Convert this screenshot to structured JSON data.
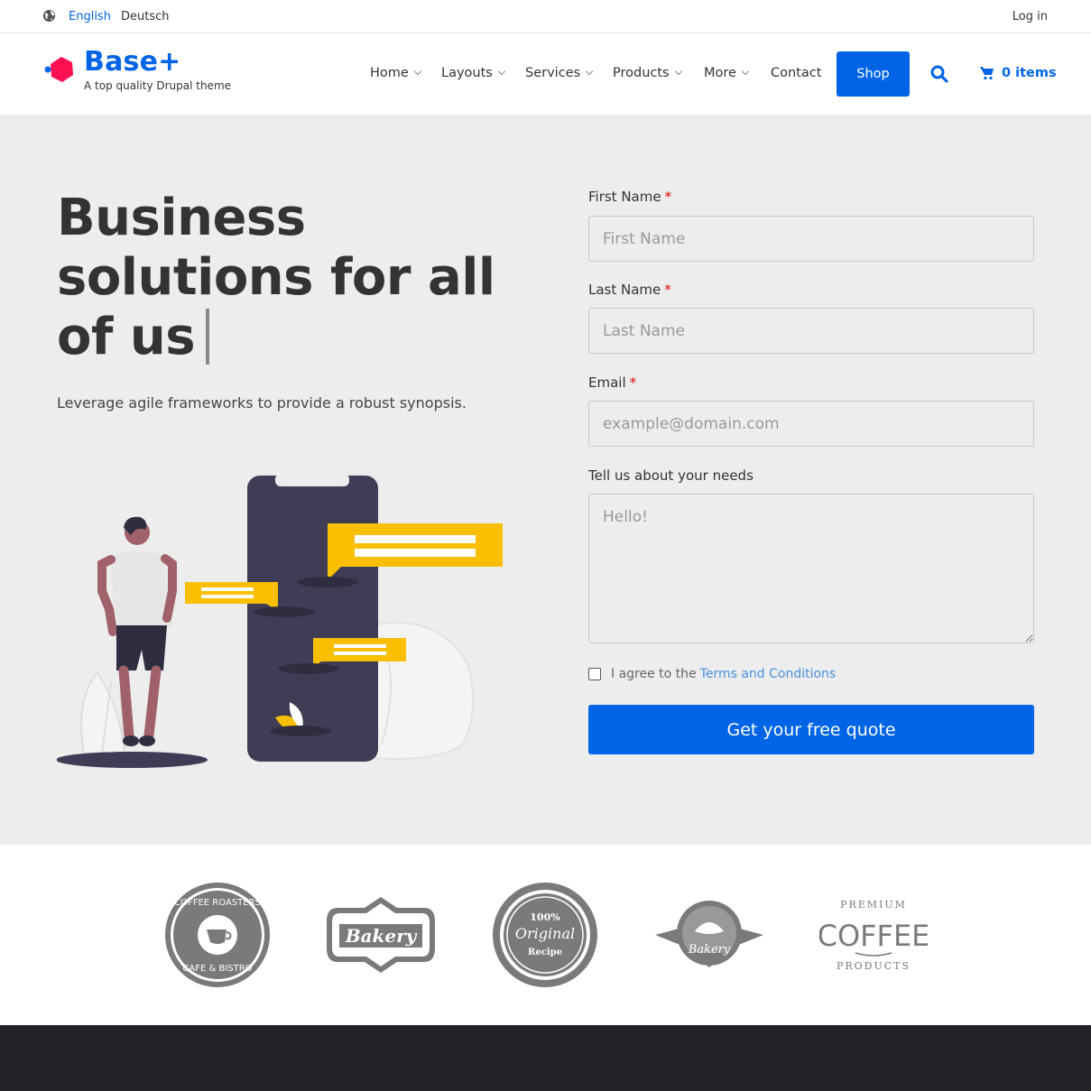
{
  "topbar": {
    "globe_icon": "globe-icon",
    "languages": [
      "English",
      "Deutsch"
    ],
    "active_language": "English",
    "login": "Log in"
  },
  "header": {
    "site_name": "Base+",
    "slogan": "A top quality Drupal theme",
    "nav": [
      {
        "label": "Home",
        "dropdown": true
      },
      {
        "label": "Layouts",
        "dropdown": true
      },
      {
        "label": "Services",
        "dropdown": true
      },
      {
        "label": "Products",
        "dropdown": true
      },
      {
        "label": "More",
        "dropdown": true
      },
      {
        "label": "Contact",
        "dropdown": false
      }
    ],
    "shop_label": "Shop",
    "search_icon": "search-icon",
    "cart_icon": "cart-icon",
    "cart_label": "0 items"
  },
  "hero": {
    "title": "Business solutions for all of us",
    "subtitle": "Leverage agile frameworks to provide a robust synopsis."
  },
  "form": {
    "first_name": {
      "label": "First Name",
      "required": "*",
      "placeholder": "First Name"
    },
    "last_name": {
      "label": "Last Name",
      "required": "*",
      "placeholder": "Last Name"
    },
    "email": {
      "label": "Email",
      "required": "*",
      "placeholder": "example@domain.com"
    },
    "needs": {
      "label": "Tell us about your needs",
      "placeholder": "Hello!"
    },
    "agree_text": "I agree to the",
    "agree_link": "Terms and Conditions",
    "submit": "Get your free quote"
  },
  "logos": {
    "coffee_roasters": {
      "top": "COFFEE ROASTERS",
      "bottom": "CAFE & BISTRO"
    },
    "bakery": "Bakery",
    "original": {
      "top": "100%",
      "middle": "Original",
      "bottom": "Recipe"
    },
    "bakery2": "Bakery",
    "premium": {
      "top": "PREMIUM",
      "middle": "COFFEE",
      "bottom": "PRODUCTS"
    }
  },
  "colors": {
    "brand": "#0064e6",
    "hero_bg": "#ededed",
    "accent_yellow": "#f9bf00",
    "footer_bg": "#222328"
  }
}
